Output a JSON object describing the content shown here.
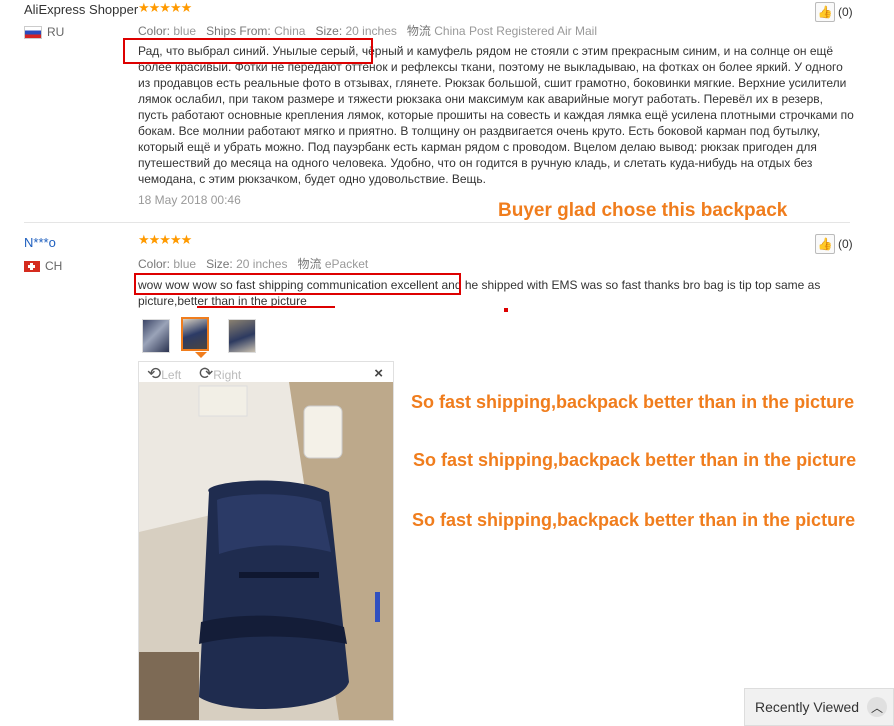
{
  "review1": {
    "author": "AliExpress Shopper",
    "country": "RU",
    "color_label": "Color:",
    "color_value": "blue",
    "ships_label": "Ships From:",
    "ships_value": "China",
    "size_label": "Size:",
    "size_value": "20 inches",
    "logistics_label": "物流",
    "logistics_value": "China Post Registered Air Mail",
    "likes": "(0)",
    "text": "Рад, что выбрал синий. Унылые серый, чёрный и камуфель рядом не стояли с этим прекрасным синим, и на солнце он ещё более красивый. Фотки не передают оттенок и рефлексы ткани, поэтому не выкладываю, на фотках он более яркий. У одного из продавцов есть реальные фото в отзывах, глянете. Рюкзак большой, сшит грамотно, боковинки мягкие. Верхние усилители лямок ослабил, при таком размере и тяжести рюкзака они максимум как аварийные могут работать. Перевёл их в резерв, пусть работают основные крепления лямок, которые прошиты на совесть и каждая лямка ещё усилена плотными строчками по бокам. Все молнии работают мягко и приятно. В толщину он раздвигается очень круто. Есть боковой карман под бутылку, который ещё и убрать можно. Под пауэрбанк есть карман рядом с проводом. Вцелом делаю вывод: рюкзак пригоден для путешествий до месяца на одного человека. Удобно, что он годится в ручную кладь, и слетать куда-нибудь на отдых без чемодана, с этим рюкзачком, будет одно удовольствие. Вещь.",
    "date": "18 May 2018 00:46"
  },
  "review2": {
    "author": "N***o",
    "country": "CH",
    "color_label": "Color:",
    "color_value": "blue",
    "size_label": "Size:",
    "size_value": "20 inches",
    "logistics_label": "物流",
    "logistics_value": "ePacket",
    "likes": "(0)",
    "text": "wow wow wow so fast shipping communication excellent and he shipped with EMS was so fast thanks bro bag is tip top same as picture,better than in the picture",
    "viewer_left": "Left",
    "viewer_right": "Right",
    "viewer_close": "×"
  },
  "annotations": {
    "note1": "Buyer glad chose this backpack",
    "note2": "So fast shipping,backpack better than in the picture",
    "note3": "So fast shipping,backpack better than in the picture",
    "note4": "So fast shipping,backpack better than in the picture"
  },
  "recently_viewed": "Recently Viewed",
  "colors": {
    "accent_orange": "#f07d1d",
    "star": "#ff9a00",
    "highlight_red": "#dd0000",
    "link_blue": "#1e5fbf"
  }
}
